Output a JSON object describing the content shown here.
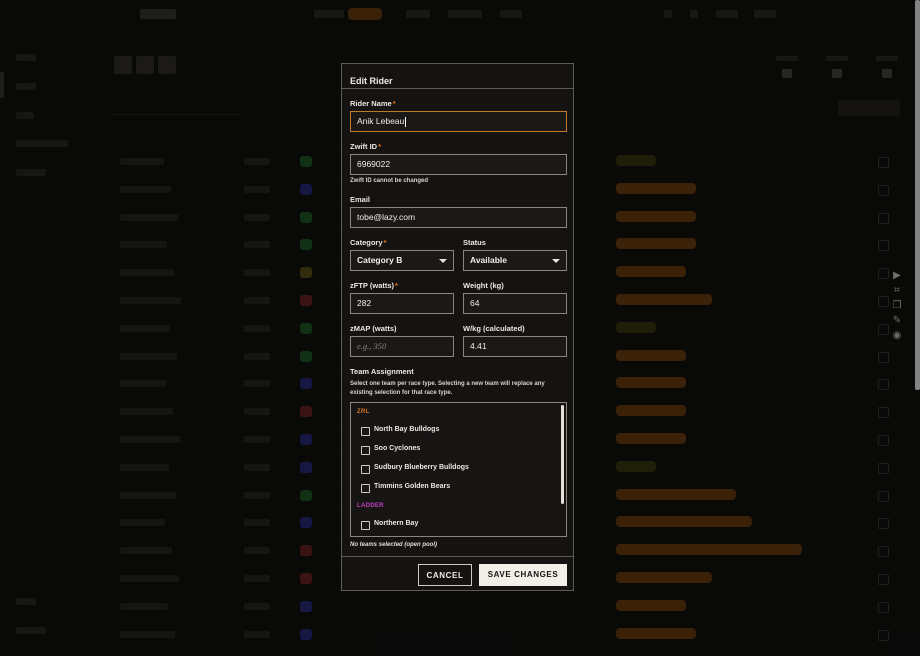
{
  "modal": {
    "title": "Edit Rider",
    "rider_name": {
      "label": "Rider Name",
      "required_mark": "*",
      "value": "Anik Lebeau"
    },
    "zwift_id": {
      "label": "Zwift ID",
      "required_mark": "*",
      "value": "6969022",
      "hint": "Zwift ID cannot be changed"
    },
    "email": {
      "label": "Email",
      "value": "tobe@lazy.com"
    },
    "category": {
      "label": "Category",
      "required_mark": "*",
      "selected": "Category B"
    },
    "status": {
      "label": "Status",
      "selected": "Available"
    },
    "zftp": {
      "label": "zFTP (watts)",
      "required_mark": "*",
      "value": "282"
    },
    "weight": {
      "label": "Weight (kg)",
      "value": "64"
    },
    "zmap": {
      "label": "zMAP (watts)",
      "placeholder": "e.g., 350"
    },
    "wkg": {
      "label": "W/kg (calculated)",
      "value": "4.41"
    },
    "team_assignment": {
      "title": "Team Assignment",
      "description_line1": "Select one team per race type. Selecting a new team will replace any",
      "description_line2": "existing selection for that race type.",
      "groups": [
        {
          "name": "ZRL",
          "color": "#d9782a",
          "teams": [
            "North Bay Bulldogs",
            "Soo Cyclones",
            "Sudbury Blueberry Bulldogs",
            "Timmins Golden Bears"
          ]
        },
        {
          "name": "LADDER",
          "color": "#c43fc4",
          "teams": [
            "Northern Bay"
          ]
        }
      ],
      "empty_note": "No teams selected (open pool)"
    },
    "buttons": {
      "cancel": "CANCEL",
      "save": "SAVE CHANGES"
    }
  },
  "colors": {
    "accent": "#e8771a",
    "focus_border": "#c47a2c",
    "zrl": "#d9782a",
    "ladder": "#c43fc4"
  },
  "icons": [
    "chevron-down-icon",
    "checkbox-icon",
    "play-icon",
    "crop-icon",
    "layers-icon",
    "pen-icon",
    "camera-icon"
  ]
}
